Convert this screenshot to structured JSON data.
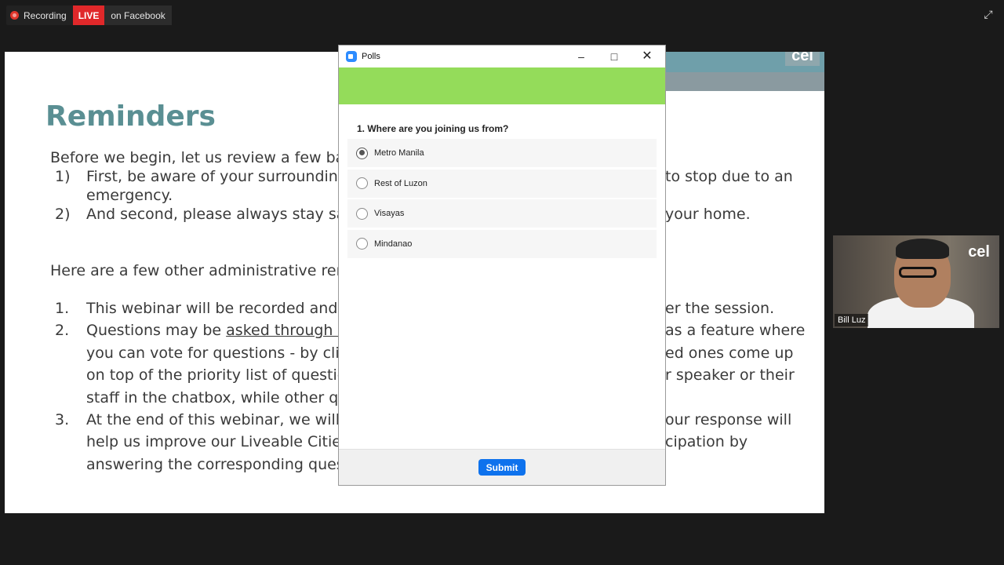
{
  "status_bar": {
    "recording_label": "Recording",
    "live_label": "LIVE",
    "platform_label": "on Facebook"
  },
  "slide": {
    "logo": "cel",
    "title": "Reminders",
    "lines": [
      "Before we begin,  let us  review a few basi",
      "1)",
      "First, be aware of your surroundings",
      "to stop due to an",
      "emergency.",
      "2)",
      "And second, please always stay safe",
      "your home.",
      "Here are a few other administrative remin",
      "1.",
      "This webinar will be recorded and a",
      "er the session.",
      "2.",
      "Questions may be ",
      "asked through the",
      "as a feature where",
      "you can vote for questions - by clicki",
      "ed ones come up",
      "on top of the priority list of questions",
      "r speaker or their",
      "staff in the chatbox, while other ques",
      "3.",
      "At the end of this webinar, we will in",
      "our response will",
      "help us improve our Liveable Cities L",
      "cipation by",
      "answering the corresponding questio"
    ]
  },
  "webcam": {
    "logo": "cel",
    "name": "Bill Luz"
  },
  "poll": {
    "window_title": "Polls",
    "question": "1. Where are you joining us from?",
    "options": [
      {
        "label": "Metro Manila",
        "selected": true
      },
      {
        "label": "Rest of Luzon",
        "selected": false
      },
      {
        "label": "Visayas",
        "selected": false
      },
      {
        "label": "Mindanao",
        "selected": false
      }
    ],
    "submit_label": "Submit",
    "header_color": "#94dc5a",
    "accent_color": "#0e72ed"
  }
}
